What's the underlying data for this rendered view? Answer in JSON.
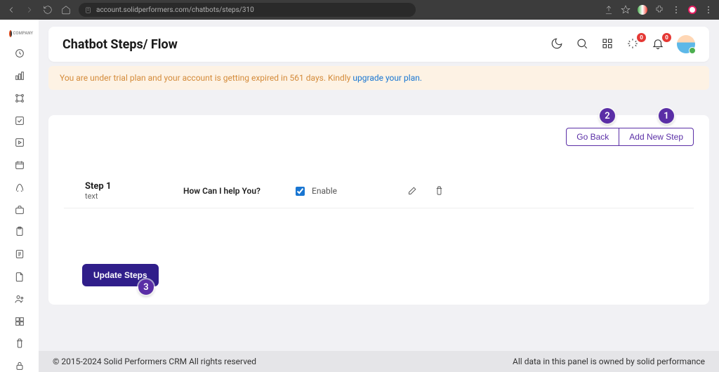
{
  "browser": {
    "url": "account.solidperformers.com/chatbots/steps/310"
  },
  "sidebar": {
    "brand": "COMPANY"
  },
  "header": {
    "title": "Chatbot Steps/ Flow",
    "notif_badge": "0",
    "bell_badge": "0"
  },
  "banner": {
    "text": "You are under trial plan and your account is getting expired in 561 days. Kindly ",
    "link": "upgrade your plan."
  },
  "actions": {
    "go_back": "Go Back",
    "add_new": "Add New Step",
    "update": "Update Steps"
  },
  "step": {
    "title": "Step 1",
    "subtitle": "text",
    "question": "How Can I help You?",
    "enable_label": "Enable",
    "checked": true
  },
  "callouts": {
    "one": "1",
    "two": "2",
    "three": "3"
  },
  "footer": {
    "left": "© 2015-2024 Solid Performers CRM All rights reserved",
    "right": "All data in this panel is owned by solid performance"
  }
}
